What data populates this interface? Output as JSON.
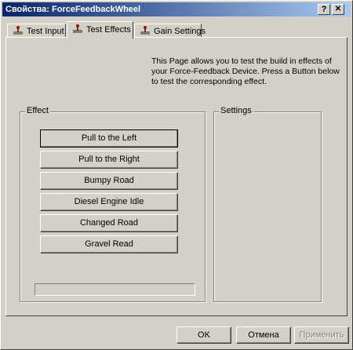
{
  "window": {
    "title": "Свойства: ForceFeedbackWheel",
    "help_glyph": "?",
    "close_glyph": "✕"
  },
  "tabs": [
    {
      "label": "Test Input",
      "active": false,
      "icon": "joystick-icon"
    },
    {
      "label": "Test Effects",
      "active": true,
      "icon": "joystick-icon"
    },
    {
      "label": "Gain Settings",
      "active": false,
      "icon": "joystick-icon"
    }
  ],
  "info_text": "This Page allows you to test the build in effects of your Force-Feedback Device. Press a Button below to test the corresponding effect.",
  "effect_group": {
    "label": "Effect",
    "buttons": [
      "Pull to the Left",
      "Pull to the Right",
      "Bumpy Road",
      "Diesel Engine Idle",
      "Changed Road",
      "Gravel Read"
    ]
  },
  "settings_group": {
    "label": "Settings"
  },
  "footer": {
    "ok_label": "OK",
    "cancel_label": "Отмена",
    "apply_label": "Применить"
  }
}
